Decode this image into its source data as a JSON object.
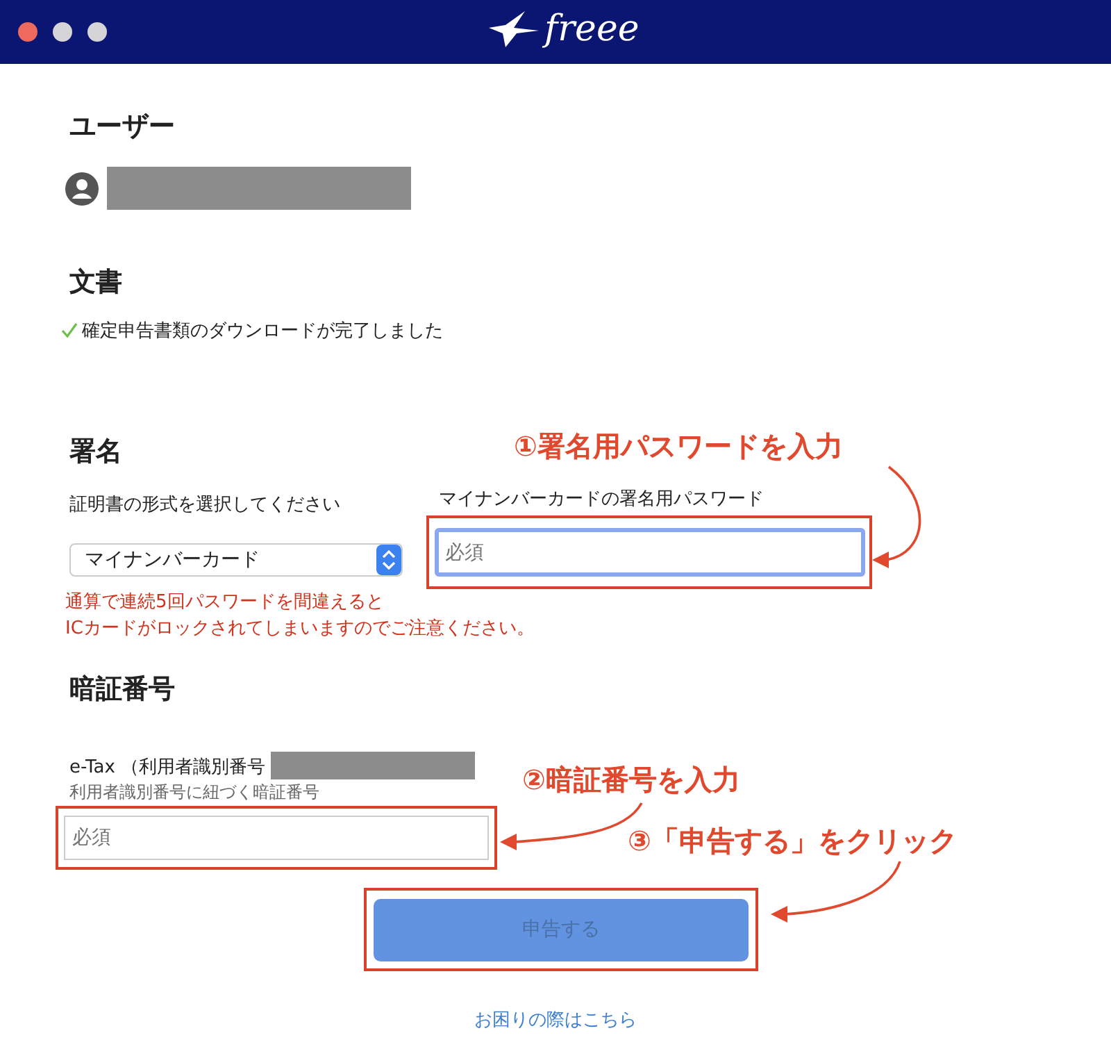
{
  "window": {
    "controls": [
      {
        "color": "#ee6a5e"
      },
      {
        "color": "#d5d5d8"
      },
      {
        "color": "#d5d5d8"
      }
    ],
    "logo": "freee"
  },
  "user": {
    "heading": "ユーザー"
  },
  "document": {
    "heading": "文書",
    "status": "確定申告書類のダウンロードが完了しました",
    "done": true
  },
  "signature": {
    "heading": "署名",
    "cert_label": "証明書の形式を選択してください",
    "cert_value": "マイナンバーカード",
    "password_label": "マイナンバーカードの署名用パスワード",
    "password_placeholder": "必須",
    "password_focused": true,
    "warning": [
      "通算で連続5回パスワードを間違えると",
      "ICカードがロックされてしまいますのでご注意ください。"
    ]
  },
  "pin": {
    "heading": "暗証番号",
    "label": "e-Tax （利用者識別番号",
    "hint": "利用者識別番号に紐づく暗証番号",
    "placeholder": "必須",
    "focused": false
  },
  "submit": {
    "label": "申告する",
    "disabled": true
  },
  "help_link": "お困りの際はこちら",
  "annotations": [
    {
      "text": "①署名用パスワードを入力"
    },
    {
      "text": "②暗証番号を入力"
    },
    {
      "text": "③「申告する」をクリック"
    }
  ]
}
